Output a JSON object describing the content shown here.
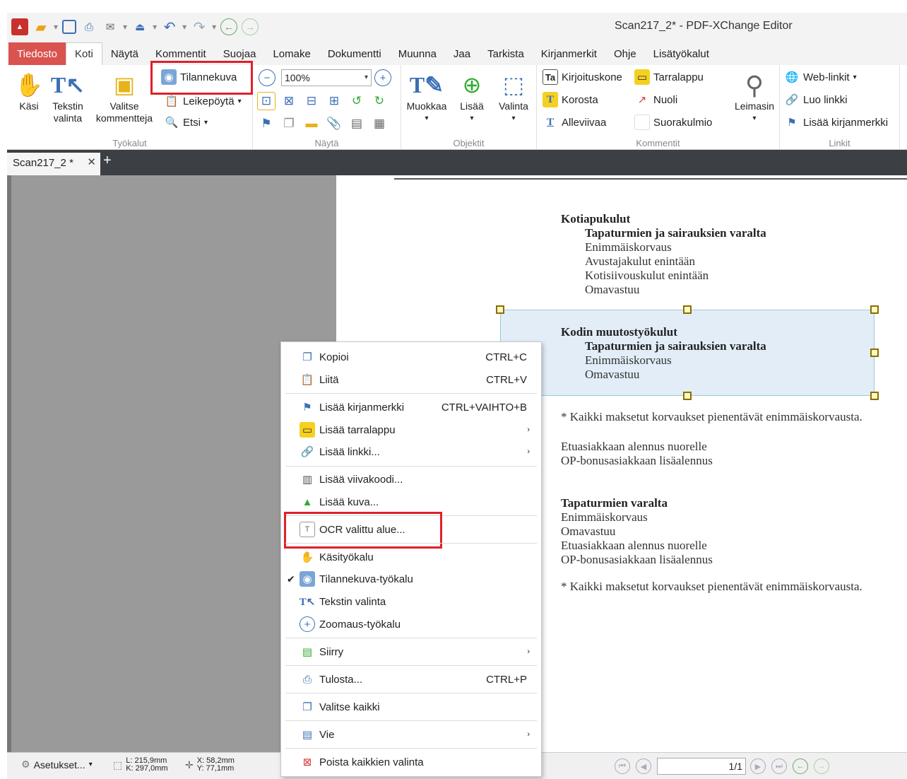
{
  "window": {
    "title": "Scan217_2* - PDF-XChange Editor"
  },
  "quick_access": [
    "pdf-app-icon",
    "folder-open-icon",
    "save-icon",
    "print-icon",
    "mail-icon",
    "scan-icon",
    "undo-icon",
    "redo-icon",
    "back-icon",
    "forward-icon"
  ],
  "menu_tabs": [
    "Tiedosto",
    "Koti",
    "Näytä",
    "Kommentit",
    "Suojaa",
    "Lomake",
    "Dokumentti",
    "Muunna",
    "Jaa",
    "Tarkista",
    "Kirjanmerkit",
    "Ohje",
    "Lisätyökalut"
  ],
  "ribbon": {
    "tyokalut": {
      "label": "Työkalut",
      "kasi": "Käsi",
      "tekstin_valinta": "Tekstin\nvalinta",
      "valitse_kommentteja": "Valitse\nkommentteja",
      "tilannekuva": "Tilannekuva",
      "leikepoyta": "Leikepöytä",
      "etsi": "Etsi"
    },
    "nayta": {
      "label": "Näytä",
      "zoom": "100%"
    },
    "objektit": {
      "label": "Objektit",
      "muokkaa": "Muokkaa",
      "lisaa": "Lisää",
      "valinta": "Valinta"
    },
    "kommentit": {
      "label": "Kommentit",
      "kirjoituskone": "Kirjoituskone",
      "tarralappu": "Tarralappu",
      "korosta": "Korosta",
      "nuoli": "Nuoli",
      "alleviivaa": "Alleviivaa",
      "suorakulmio": "Suorakulmio",
      "leimasin": "Leimasin"
    },
    "linkit": {
      "label": "Linkit",
      "web_linkit": "Web-linkit",
      "luo_linkki": "Luo linkki",
      "lisaa_kirjanmerkki": "Lisää kirjanmerkki"
    }
  },
  "doc_tab": {
    "name": "Scan217_2 *"
  },
  "document": {
    "s1_title": "Kotiapukulut",
    "s1_sub": "Tapaturmien ja sairauksien varalta",
    "s1_lines": [
      "Enimmäiskorvaus",
      "Avustajakulut enintään",
      "Kotisiivouskulut enintään",
      "Omavastuu"
    ],
    "s2_title": "Kodin muutostyökulut",
    "s2_sub": "Tapaturmien ja sairauksien varalta",
    "s2_lines": [
      "Enimmäiskorvaus",
      "Omavastuu"
    ],
    "note1": "* Kaikki maksetut korvaukset pienentävät enimmäiskorvausta.",
    "s3_lines": [
      "Etuasiakkaan alennus nuorelle",
      "OP-bonusasiakkaan lisäalennus"
    ],
    "s4_title": "Tapaturmien varalta",
    "s4_lines": [
      "Enimmäiskorvaus",
      "Omavastuu",
      "Etuasiakkaan alennus nuorelle",
      "OP-bonusasiakkaan lisäalennus"
    ],
    "note2": "* Kaikki maksetut korvaukset pienentävät enimmäiskorvausta."
  },
  "context_menu": {
    "kopioi": {
      "label": "Kopioi",
      "shortcut": "CTRL+C"
    },
    "liita": {
      "label": "Liitä",
      "shortcut": "CTRL+V"
    },
    "lisaa_kirjanmerkki": {
      "label": "Lisää kirjanmerkki",
      "shortcut": "CTRL+VAIHTO+B"
    },
    "lisaa_tarralappu": {
      "label": "Lisää tarralappu"
    },
    "lisaa_linkki": {
      "label": "Lisää linkki..."
    },
    "lisaa_viivakoodi": {
      "label": "Lisää viivakoodi..."
    },
    "lisaa_kuva": {
      "label": "Lisää kuva..."
    },
    "ocr": {
      "label": "OCR valittu alue..."
    },
    "kasityokalu": {
      "label": "Käsityökalu"
    },
    "tilannekuva_tyokalu": {
      "label": "Tilannekuva-työkalu"
    },
    "tekstin_valinta": {
      "label": "Tekstin valinta"
    },
    "zoomaus": {
      "label": "Zoomaus-työkalu"
    },
    "siirry": {
      "label": "Siirry"
    },
    "tulosta": {
      "label": "Tulosta...",
      "shortcut": "CTRL+P"
    },
    "valitse_kaikki": {
      "label": "Valitse kaikki"
    },
    "vie": {
      "label": "Vie"
    },
    "poista_valinta": {
      "label": "Poista kaikkien valinta"
    }
  },
  "statusbar": {
    "settings": "Asetukset...",
    "l": "L: 215,9mm",
    "k": "K: 297,0mm",
    "x": "X: 58,2mm",
    "y": "Y: 77,1mm",
    "page": "1/1"
  },
  "colors": {
    "file_tab": "#d9534f",
    "highlight_box": "#e0202a",
    "doc_tab_bar": "#3c3f44"
  }
}
